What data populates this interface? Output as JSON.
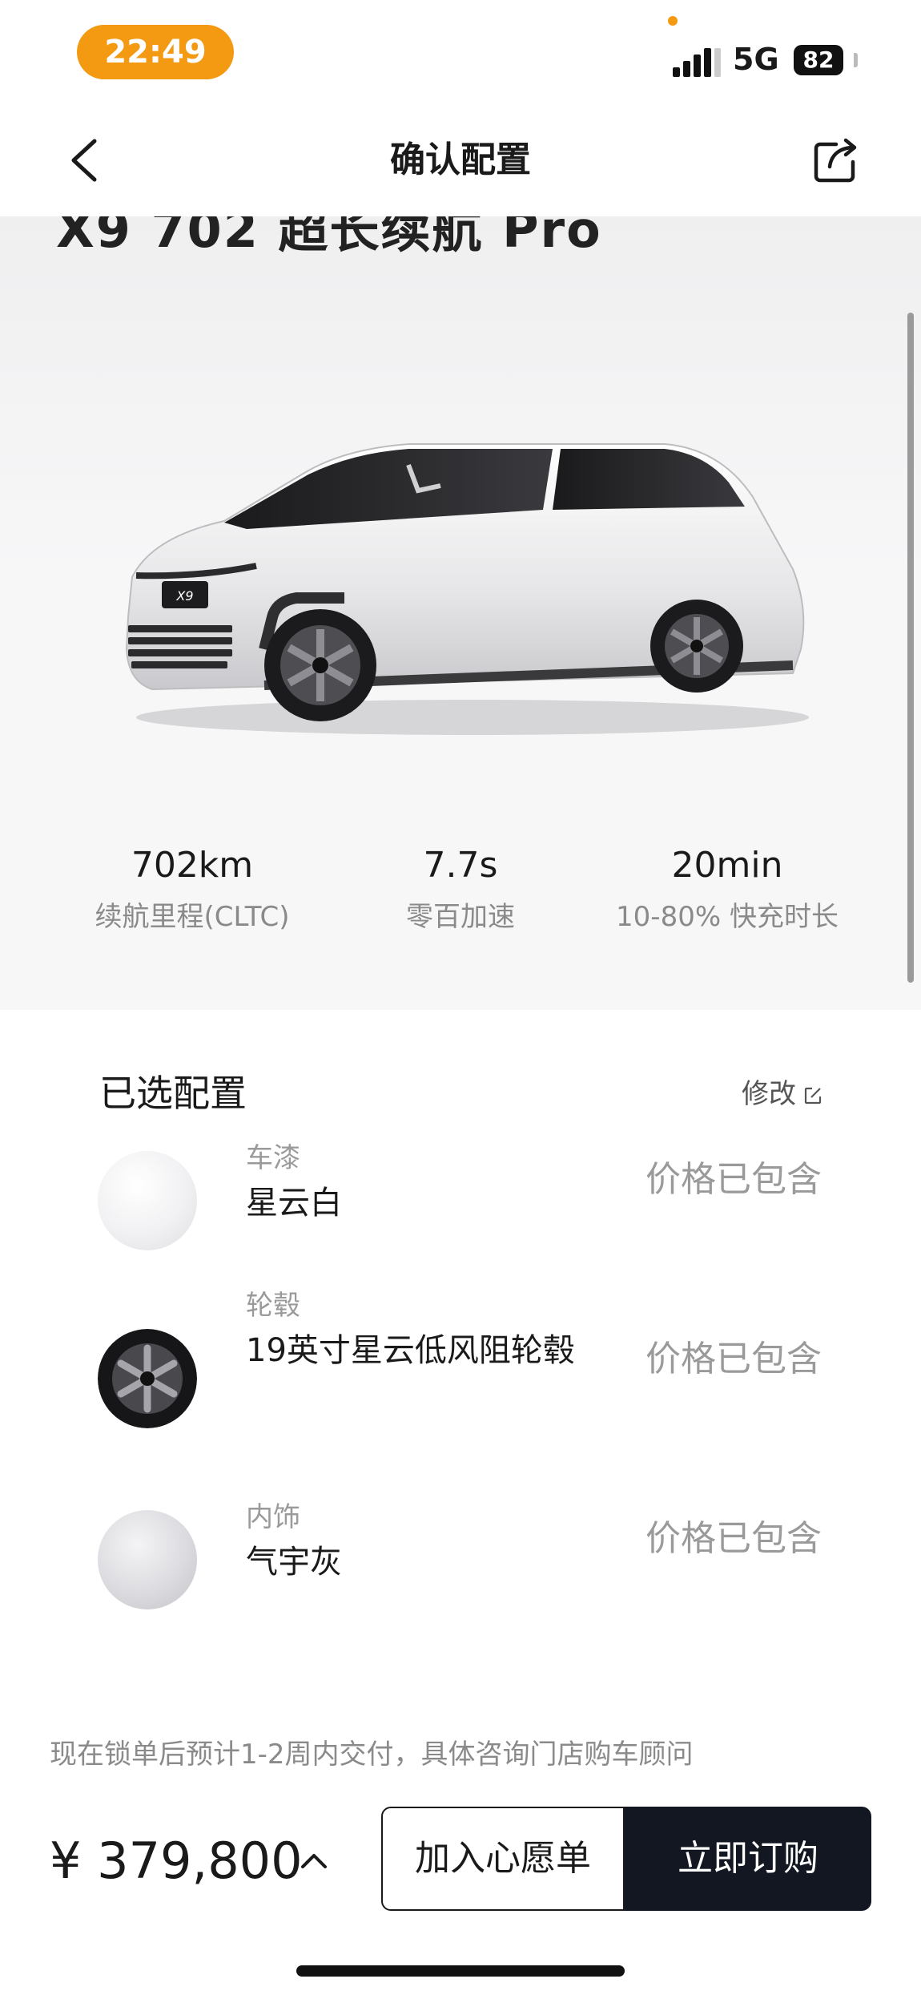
{
  "status_bar": {
    "time": "22:49",
    "network": "5G",
    "battery": "82"
  },
  "nav": {
    "title": "确认配置",
    "back_icon": "chevron-left-icon",
    "share_icon": "share-icon"
  },
  "hero": {
    "title_partial": "X9 702 超长续航 Pro",
    "car_badge": "X9"
  },
  "stats": [
    {
      "value": "702km",
      "label": "续航里程(CLTC)"
    },
    {
      "value": "7.7s",
      "label": "零百加速"
    },
    {
      "value": "20min",
      "label": "10-80% 快充时长"
    }
  ],
  "config": {
    "title": "已选配置",
    "edit": "修改",
    "items": [
      {
        "category": "车漆",
        "value": "星云白",
        "price": "价格已包含"
      },
      {
        "category": "轮毂",
        "value": "19英寸星云低风阻轮毂",
        "price": "价格已包含"
      },
      {
        "category": "内饰",
        "value": "气宇灰",
        "price": "价格已包含"
      }
    ]
  },
  "bottom": {
    "notice": "现在锁单后预计1-2周内交付，具体咨询门店购车顾问",
    "price": "¥ 379,800",
    "wishlist": "加入心愿单",
    "buy": "立即订购"
  },
  "colors": {
    "accent": "#f39a12",
    "primary_button": "#121722",
    "muted_text": "#9a9a9a"
  }
}
